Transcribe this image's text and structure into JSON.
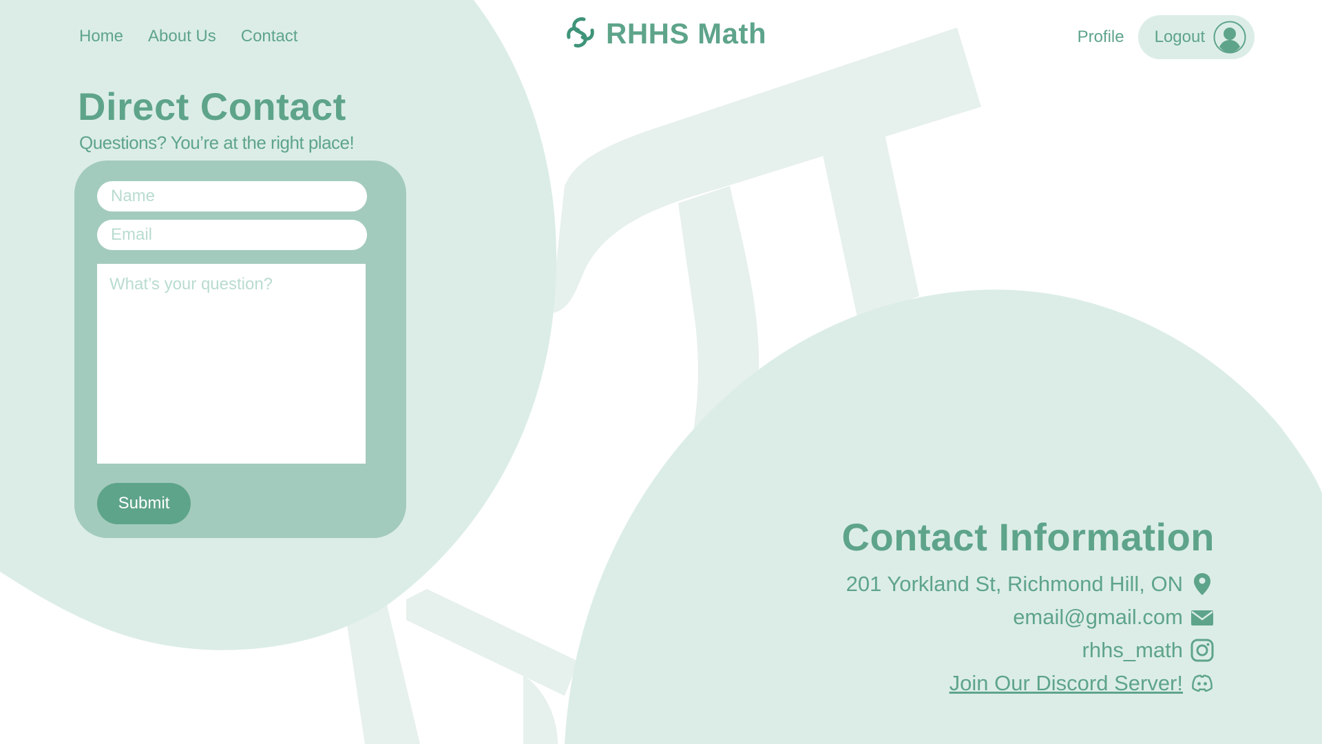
{
  "nav": {
    "links": [
      {
        "label": "Home"
      },
      {
        "label": "About Us"
      },
      {
        "label": "Contact"
      }
    ],
    "brand": "RHHS Math",
    "profile_label": "Profile",
    "logout_label": "Logout"
  },
  "direct_contact": {
    "title": "Direct Contact",
    "subtitle": "Questions? You’re at the right place!",
    "name_placeholder": "Name",
    "email_placeholder": "Email",
    "question_placeholder": "What’s your question?",
    "submit_label": "Submit"
  },
  "contact_info": {
    "title": "Contact Information",
    "address": "201 Yorkland St, Richmond Hill, ON",
    "email": "email@gmail.com",
    "instagram": "rhhs_math",
    "discord": "Join Our Discord Server!",
    "icons": {
      "address": "location-pin-icon",
      "email": "envelope-icon",
      "instagram": "instagram-icon",
      "discord": "discord-icon"
    }
  },
  "colors": {
    "accent": "#5ea48a",
    "card": "#a3cbbd",
    "blob": "#dcede7",
    "pi_watermark": "#e6f0ec",
    "background": "#ffffff"
  }
}
